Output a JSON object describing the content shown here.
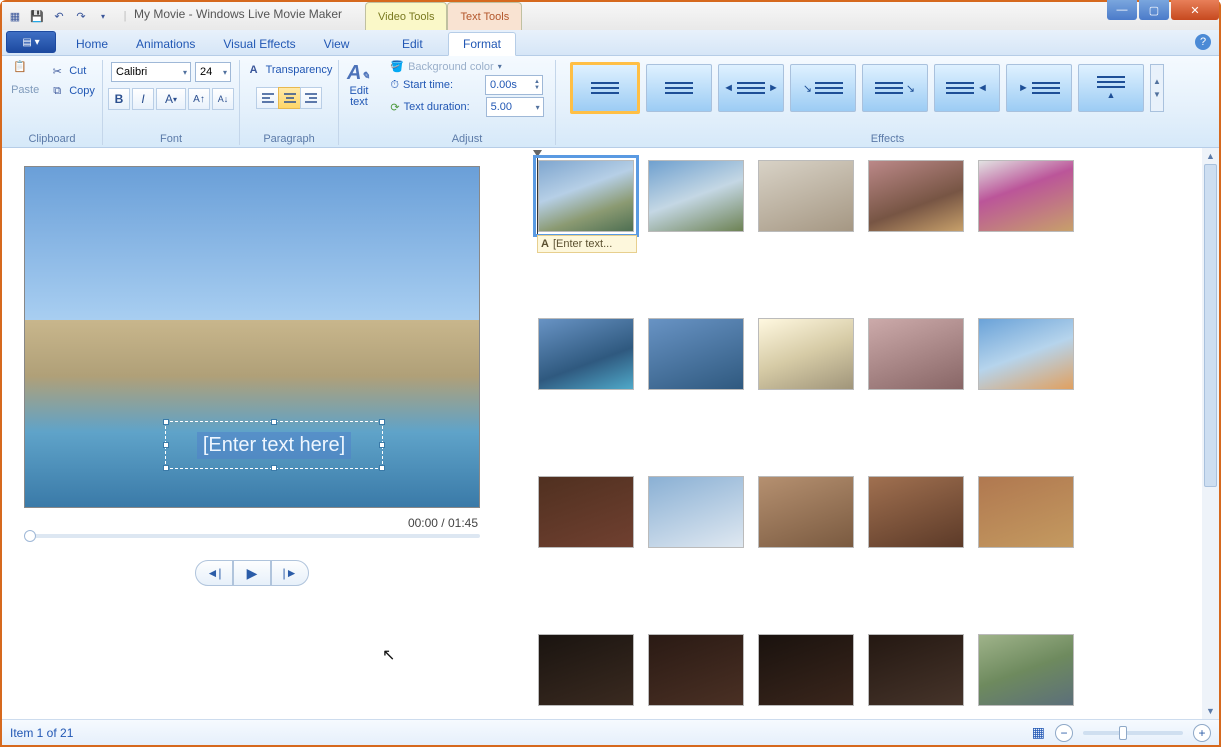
{
  "window": {
    "title": "My Movie - Windows Live Movie Maker",
    "context_tabs": {
      "video": "Video Tools",
      "text": "Text Tools"
    }
  },
  "tabs": {
    "home": "Home",
    "animations": "Animations",
    "visual_effects": "Visual Effects",
    "view": "View",
    "edit": "Edit",
    "format": "Format"
  },
  "ribbon": {
    "clipboard": {
      "label": "Clipboard",
      "paste": "Paste",
      "cut": "Cut",
      "copy": "Copy"
    },
    "font": {
      "label": "Font",
      "name": "Calibri",
      "size": "24"
    },
    "paragraph": {
      "label": "Paragraph",
      "transparency": "Transparency"
    },
    "edit_text": {
      "label": "Edit\ntext"
    },
    "adjust": {
      "label": "Adjust",
      "background_color": "Background color",
      "start_time_label": "Start time:",
      "start_time_value": "0.00s",
      "duration_label": "Text duration:",
      "duration_value": "5.00"
    },
    "effects": {
      "label": "Effects"
    }
  },
  "preview": {
    "overlay_text": "[Enter text here]",
    "time": "00:00 / 01:45"
  },
  "storyboard": {
    "text_badge": "[Enter text..."
  },
  "status": {
    "item": "Item 1 of 21"
  }
}
